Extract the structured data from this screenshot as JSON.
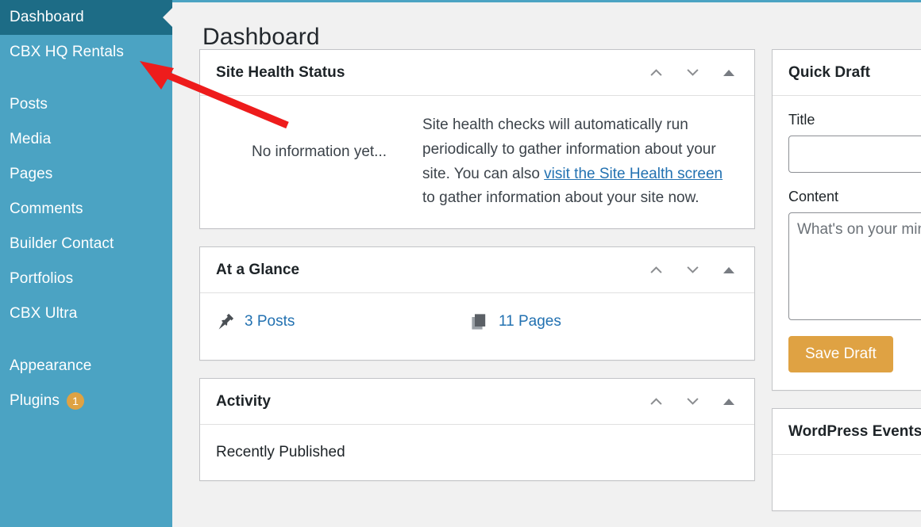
{
  "sidebar": {
    "items": [
      {
        "label": "Dashboard",
        "name": "dashboard",
        "current": true
      },
      {
        "label": "CBX HQ Rentals",
        "name": "cbx-hq-rentals",
        "current": false
      },
      {
        "label": "Posts",
        "name": "posts",
        "current": false
      },
      {
        "label": "Media",
        "name": "media",
        "current": false
      },
      {
        "label": "Pages",
        "name": "pages",
        "current": false
      },
      {
        "label": "Comments",
        "name": "comments",
        "current": false
      },
      {
        "label": "Builder Contact",
        "name": "builder-contact",
        "current": false
      },
      {
        "label": "Portfolios",
        "name": "portfolios",
        "current": false
      },
      {
        "label": "CBX Ultra",
        "name": "cbx-ultra",
        "current": false
      },
      {
        "label": "Appearance",
        "name": "appearance",
        "current": false
      },
      {
        "label": "Plugins",
        "name": "plugins",
        "current": false,
        "badge": "1"
      }
    ],
    "colors": {
      "background": "#4ba3c3",
      "current_background": "#1d6c86",
      "text": "#ffffff",
      "badge_background": "#dfa243"
    }
  },
  "header": {
    "page_title": "Dashboard"
  },
  "panels": {
    "site_health": {
      "title": "Site Health Status",
      "no_info": "No information yet...",
      "text_before_link": "Site health checks will automatically run periodically to gather information about your site. You can also ",
      "link_text": "visit the Site Health screen",
      "text_after_link": " to gather information about your site now."
    },
    "at_a_glance": {
      "title": "At a Glance",
      "items": [
        {
          "icon": "pin-icon",
          "label": "3 Posts"
        },
        {
          "icon": "pages-icon",
          "label": "11 Pages"
        }
      ]
    },
    "activity": {
      "title": "Activity",
      "subheading": "Recently Published"
    },
    "quick_draft": {
      "title": "Quick Draft",
      "title_label": "Title",
      "title_value": "",
      "title_placeholder": "",
      "content_label": "Content",
      "content_value": "",
      "content_placeholder": "What's on your mind?",
      "save_label": "Save Draft",
      "save_color": "#dfa243"
    },
    "wordpress_events": {
      "title": "WordPress Events and News"
    }
  },
  "panel_controls": {
    "move_up": "Move up",
    "move_down": "Move down",
    "toggle": "Toggle panel"
  },
  "annotation": {
    "type": "arrow",
    "color": "#ee1c1c",
    "points_to": "CBX HQ Rentals"
  },
  "link_color": "#2271b1"
}
